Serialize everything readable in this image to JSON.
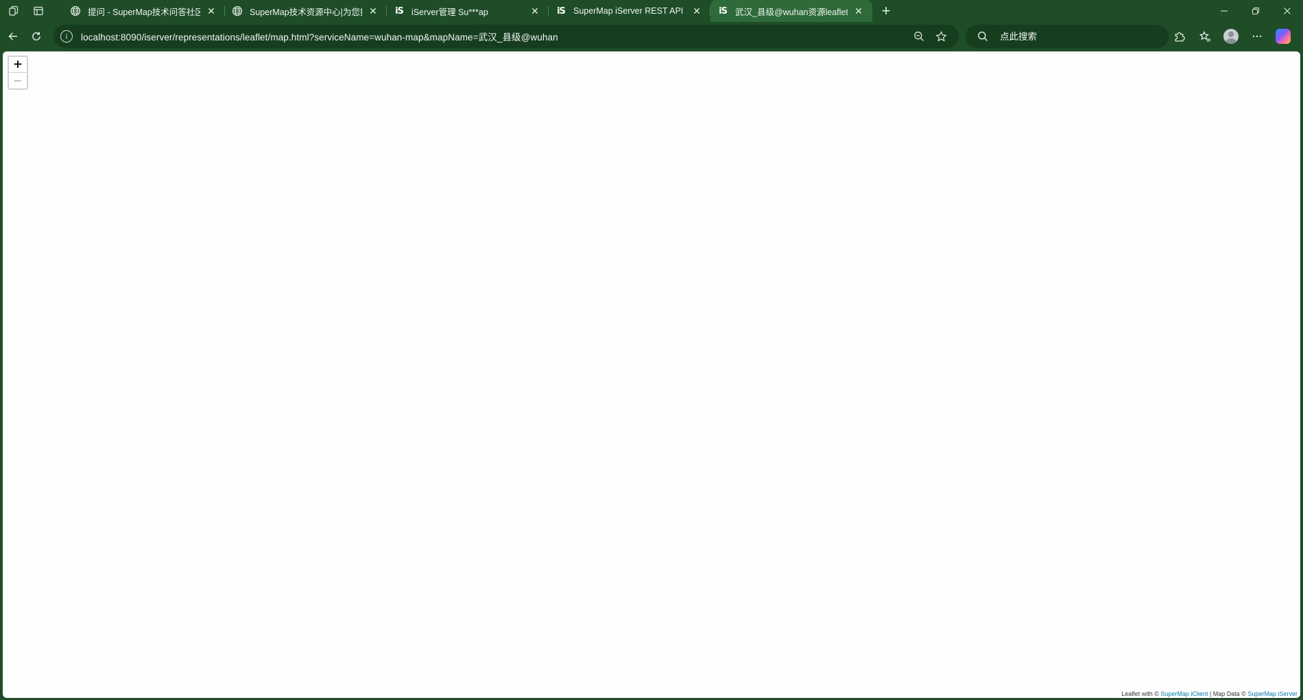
{
  "tabstrip": {
    "workspaces_icon": "workspaces-icon",
    "tab_actions_icon": "tab-actions-icon",
    "tabs": [
      {
        "title": "提问 - SuperMap技术问答社区",
        "icon": "globe-icon",
        "active": false
      },
      {
        "title": "SuperMap技术资源中心|为您提供",
        "icon": "globe-icon",
        "active": false
      },
      {
        "title": "iServer管理 Su***ap",
        "icon": "iserver-icon",
        "active": false
      },
      {
        "title": "SuperMap iServer REST API Su***",
        "icon": "iserver-icon",
        "active": false
      },
      {
        "title": "武汉_县级@wuhan资源leaflet表述",
        "icon": "iserver-icon",
        "active": true
      }
    ],
    "iserver_icon_text": "iS",
    "close_glyph": "✕",
    "new_tab_glyph": "+"
  },
  "window_controls": {
    "minimize": "—",
    "restore": "❐",
    "close": "✕"
  },
  "toolbar": {
    "url": "localhost:8090/iserver/representations/leaflet/map.html?serviceName=wuhan-map&mapName=武汉_县级@wuhan",
    "search_placeholder": "点此搜索",
    "search_value": ""
  },
  "map": {
    "zoom_in": "+",
    "zoom_out": "−",
    "attribution": {
      "prefix": "Leaflet with © ",
      "link1": "SuperMap iClient",
      "middle": " | Map Data © ",
      "link2": "SuperMap iServer"
    }
  },
  "colors": {
    "frame": "#1e4d27",
    "active_tab": "#2e6a3a",
    "address_bar": "#163d1e",
    "map_background": "#fdfdfd",
    "link": "#0078a8"
  }
}
